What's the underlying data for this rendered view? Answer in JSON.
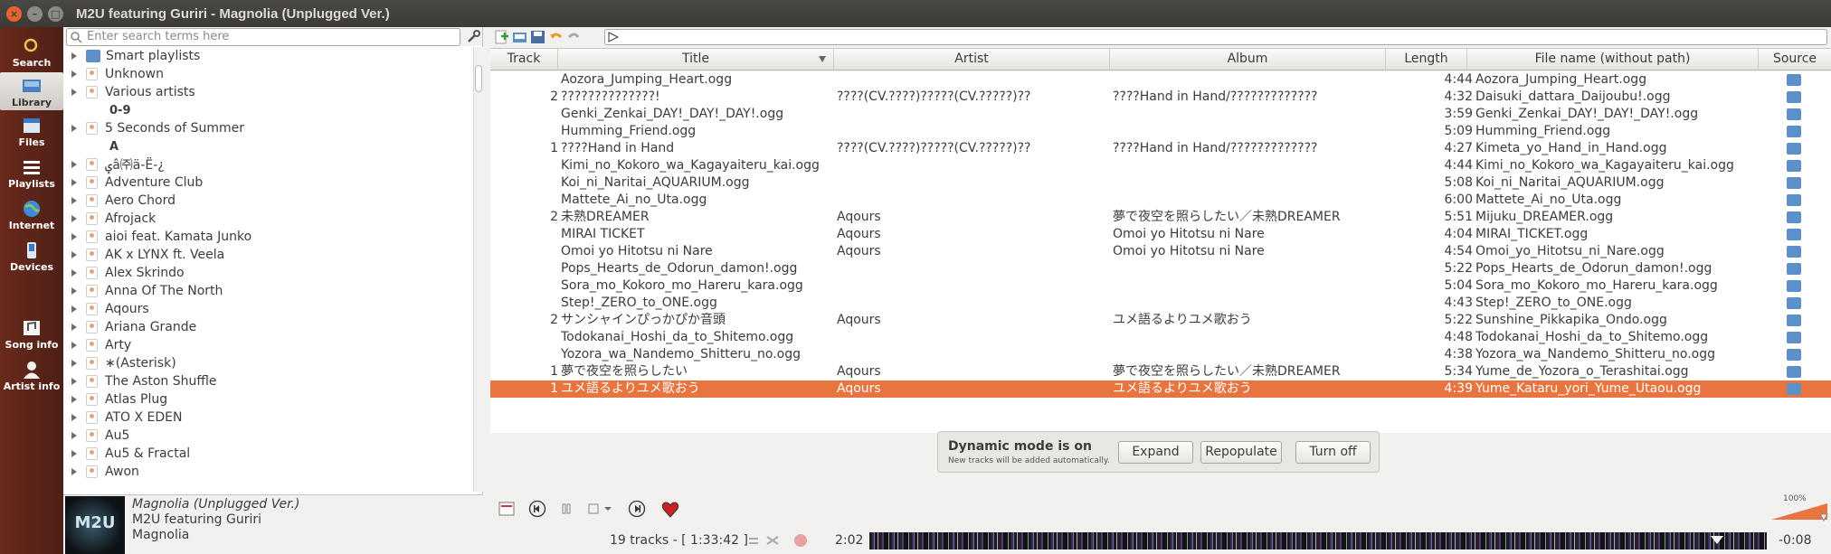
{
  "window": {
    "title": "M2U featuring Guriri - Magnolia (Unplugged Ver.)"
  },
  "sidebar": {
    "items": [
      {
        "label": "Search",
        "icon": "search-icon"
      },
      {
        "label": "Library",
        "icon": "library-icon",
        "selected": true
      },
      {
        "label": "Files",
        "icon": "files-icon"
      },
      {
        "label": "Playlists",
        "icon": "playlists-icon"
      },
      {
        "label": "Internet",
        "icon": "internet-icon"
      },
      {
        "label": "Devices",
        "icon": "devices-icon"
      },
      {
        "label": "Song info",
        "icon": "song-info-icon"
      },
      {
        "label": "Artist info",
        "icon": "artist-info-icon"
      }
    ]
  },
  "library": {
    "search_placeholder": "Enter search terms here",
    "tree": [
      {
        "label": "Smart playlists",
        "kind": "smart"
      },
      {
        "label": "Unknown",
        "kind": "artist"
      },
      {
        "label": "Various artists",
        "kind": "artist"
      },
      {
        "label": "0-9",
        "kind": "divider"
      },
      {
        "label": "5 Seconds of Summer",
        "kind": "artist"
      },
      {
        "label": "A",
        "kind": "divider"
      },
      {
        "label": "ؠâ㈜ä-Ë-¿",
        "kind": "artist"
      },
      {
        "label": "Adventure Club",
        "kind": "artist"
      },
      {
        "label": "Aero Chord",
        "kind": "artist"
      },
      {
        "label": "Afrojack",
        "kind": "artist"
      },
      {
        "label": "aioi feat. Kamata Junko",
        "kind": "artist"
      },
      {
        "label": "AK x LYNX ft. Veela",
        "kind": "artist"
      },
      {
        "label": "Alex Skrindo",
        "kind": "artist"
      },
      {
        "label": "Anna Of The North",
        "kind": "artist"
      },
      {
        "label": "Aqours",
        "kind": "artist"
      },
      {
        "label": "Ariana Grande",
        "kind": "artist"
      },
      {
        "label": "Arty",
        "kind": "artist"
      },
      {
        "label": "∗(Asterisk)",
        "kind": "artist"
      },
      {
        "label": "The Aston Shuffle",
        "kind": "artist"
      },
      {
        "label": "Atlas Plug",
        "kind": "artist"
      },
      {
        "label": "ATO X EDEN",
        "kind": "artist"
      },
      {
        "label": "Au5",
        "kind": "artist"
      },
      {
        "label": "Au5 & Fractal",
        "kind": "artist"
      },
      {
        "label": "Awon",
        "kind": "artist"
      }
    ]
  },
  "now_playing": {
    "title": "Magnolia (Unplugged Ver.)",
    "artist": "M2U featuring Guriri",
    "album": "Magnolia",
    "cover_text": "M2U"
  },
  "playlist": {
    "columns": [
      "Track",
      "Title",
      "Artist",
      "Album",
      "Length",
      "File name (without path)",
      "Source"
    ],
    "rows": [
      {
        "track": "",
        "title": "Aozora_Jumping_Heart.ogg",
        "artist": "",
        "album": "",
        "length": "4:44",
        "file": "Aozora_Jumping_Heart.ogg"
      },
      {
        "track": "2",
        "title": "??????????????!",
        "artist": "????(CV.????)?????(CV.?????)??",
        "album": "????Hand in Hand/?????????????",
        "length": "4:32",
        "file": "Daisuki_dattara_Daijoubu!.ogg"
      },
      {
        "track": "",
        "title": "Genki_Zenkai_DAY!_DAY!_DAY!.ogg",
        "artist": "",
        "album": "",
        "length": "3:59",
        "file": "Genki_Zenkai_DAY!_DAY!_DAY!.ogg"
      },
      {
        "track": "",
        "title": "Humming_Friend.ogg",
        "artist": "",
        "album": "",
        "length": "5:09",
        "file": "Humming_Friend.ogg"
      },
      {
        "track": "1",
        "title": "????Hand in Hand",
        "artist": "????(CV.????)?????(CV.?????)??",
        "album": "????Hand in Hand/?????????????",
        "length": "4:27",
        "file": "Kimeta_yo_Hand_in_Hand.ogg"
      },
      {
        "track": "",
        "title": "Kimi_no_Kokoro_wa_Kagayaiteru_kai.ogg",
        "artist": "",
        "album": "",
        "length": "4:44",
        "file": "Kimi_no_Kokoro_wa_Kagayaiteru_kai.ogg"
      },
      {
        "track": "",
        "title": "Koi_ni_Naritai_AQUARIUM.ogg",
        "artist": "",
        "album": "",
        "length": "5:08",
        "file": "Koi_ni_Naritai_AQUARIUM.ogg"
      },
      {
        "track": "",
        "title": "Mattete_Ai_no_Uta.ogg",
        "artist": "",
        "album": "",
        "length": "6:00",
        "file": "Mattete_Ai_no_Uta.ogg"
      },
      {
        "track": "2",
        "title": "未熟DREAMER",
        "artist": "Aqours",
        "album": "夢で夜空を照らしたい／未熟DREAMER",
        "length": "5:51",
        "file": "Mijuku_DREAMER.ogg"
      },
      {
        "track": "",
        "title": "MIRAI TICKET",
        "artist": "Aqours",
        "album": "Omoi yo Hitotsu ni Nare",
        "length": "4:04",
        "file": "MIRAI_TICKET.ogg"
      },
      {
        "track": "",
        "title": "Omoi yo Hitotsu ni Nare",
        "artist": "Aqours",
        "album": "Omoi yo Hitotsu ni Nare",
        "length": "4:54",
        "file": "Omoi_yo_Hitotsu_ni_Nare.ogg"
      },
      {
        "track": "",
        "title": "Pops_Hearts_de_Odorun_damon!.ogg",
        "artist": "",
        "album": "",
        "length": "5:22",
        "file": "Pops_Hearts_de_Odorun_damon!.ogg"
      },
      {
        "track": "",
        "title": "Sora_mo_Kokoro_mo_Hareru_kara.ogg",
        "artist": "",
        "album": "",
        "length": "5:04",
        "file": "Sora_mo_Kokoro_mo_Hareru_kara.ogg"
      },
      {
        "track": "",
        "title": "Step!_ZERO_to_ONE.ogg",
        "artist": "",
        "album": "",
        "length": "4:43",
        "file": "Step!_ZERO_to_ONE.ogg"
      },
      {
        "track": "2",
        "title": "サンシャインぴっかぴか音頭",
        "artist": "Aqours",
        "album": "ユメ語るよりユメ歌おう",
        "length": "5:22",
        "file": "Sunshine_Pikkapika_Ondo.ogg"
      },
      {
        "track": "",
        "title": "Todokanai_Hoshi_da_to_Shitemo.ogg",
        "artist": "",
        "album": "",
        "length": "4:48",
        "file": "Todokanai_Hoshi_da_to_Shitemo.ogg"
      },
      {
        "track": "",
        "title": "Yozora_wa_Nandemo_Shitteru_no.ogg",
        "artist": "",
        "album": "",
        "length": "4:38",
        "file": "Yozora_wa_Nandemo_Shitteru_no.ogg"
      },
      {
        "track": "1",
        "title": "夢で夜空を照らしたい",
        "artist": "Aqours",
        "album": "夢で夜空を照らしたい／未熟DREAMER",
        "length": "5:34",
        "file": "Yume_de_Yozora_o_Terashitai.ogg"
      },
      {
        "track": "1",
        "title": "ユメ語るよりユメ歌おう",
        "artist": "Aqours",
        "album": "ユメ語るよりユメ歌おう",
        "length": "4:39",
        "file": "Yume_Kataru_yori_Yume_Utaou.ogg",
        "selected": true
      }
    ]
  },
  "dynamic_mode": {
    "title": "Dynamic mode is on",
    "subtitle": "New tracks will be added automatically.",
    "expand_label": "Expand",
    "repopulate_label": "Repopulate",
    "turnoff_label": "Turn off"
  },
  "player": {
    "volume_label": "100%",
    "volume_level": 1.0,
    "tracks_summary": "19 tracks - [ 1:33:42 ]",
    "elapsed": "2:02",
    "remaining": "-0:08",
    "accent_color": "#e8743f"
  }
}
